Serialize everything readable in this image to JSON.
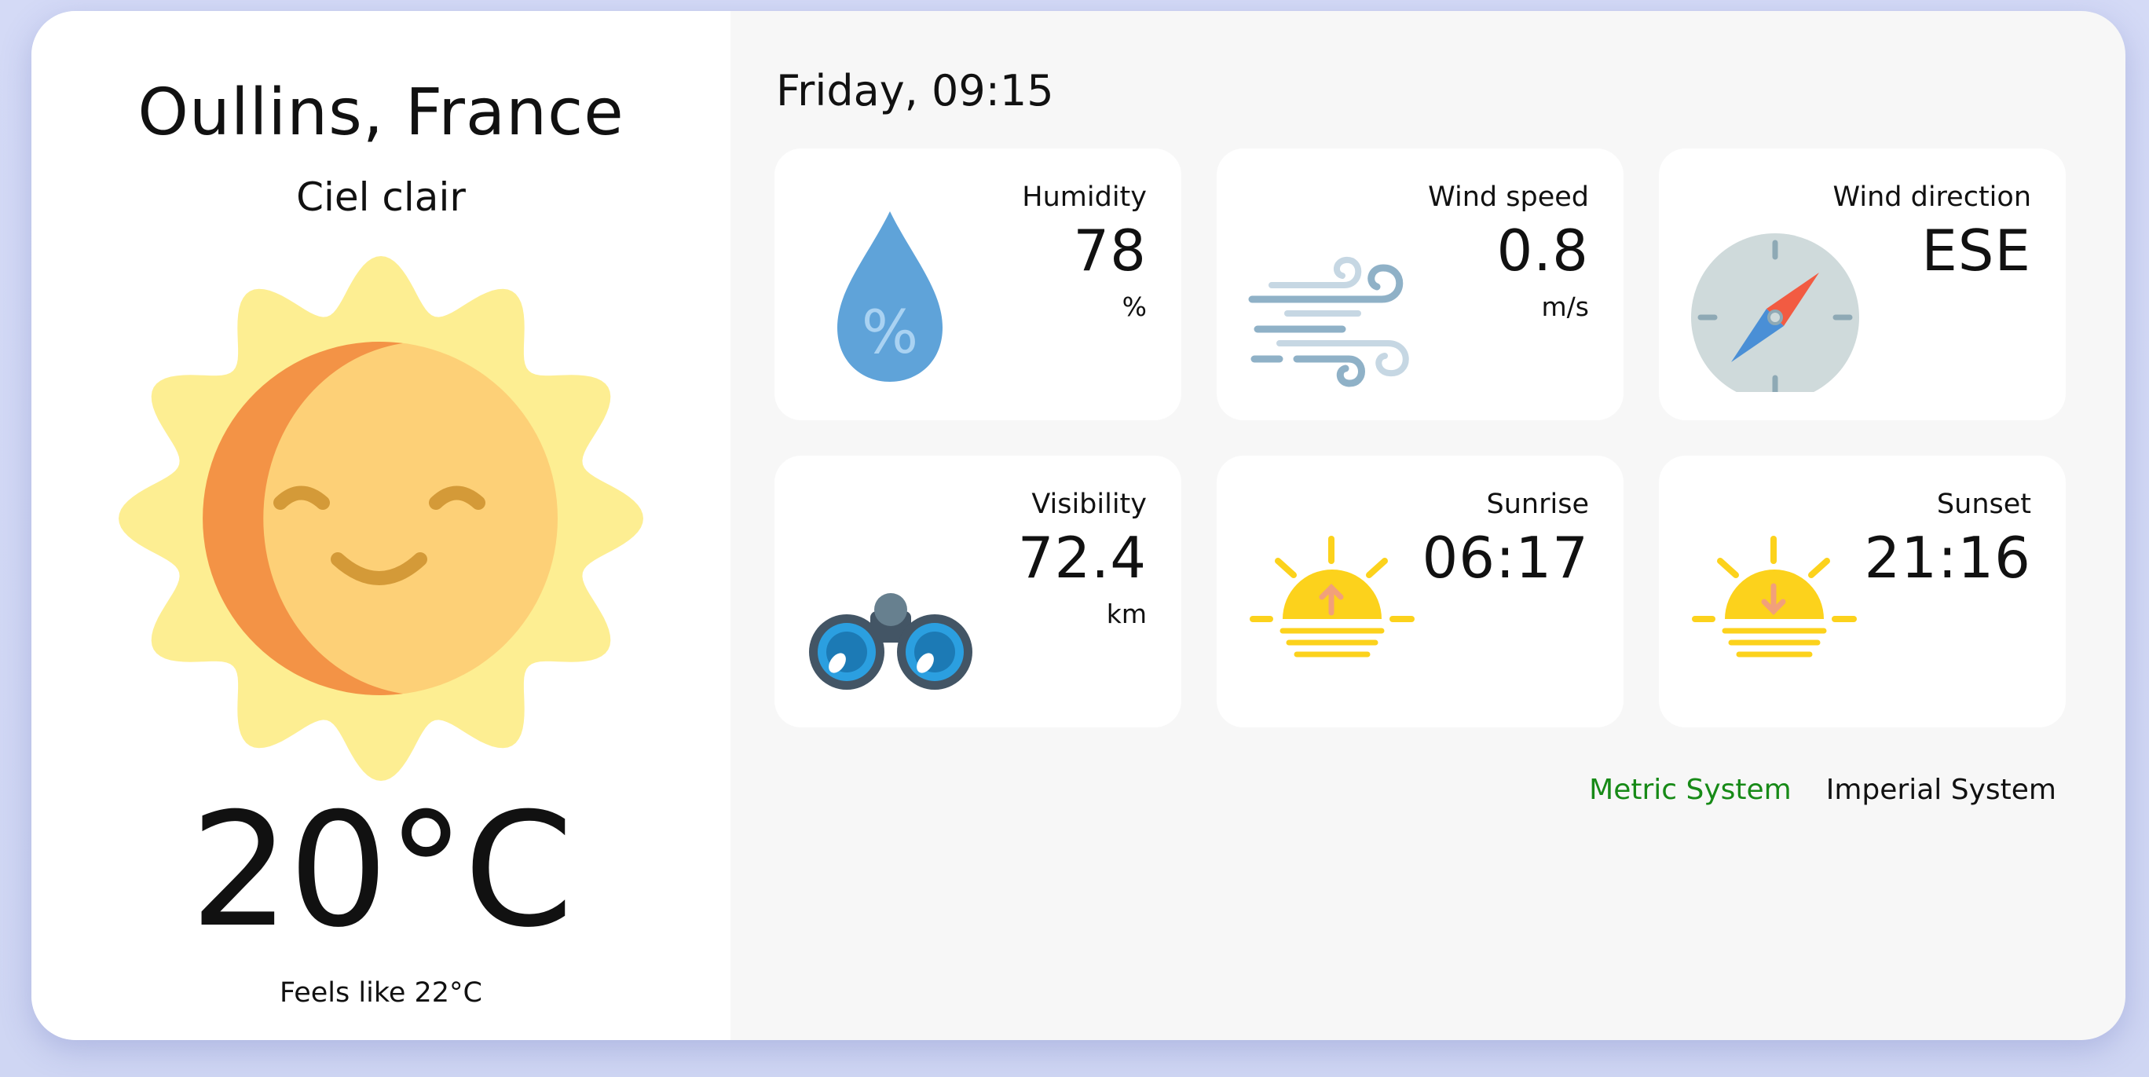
{
  "location": {
    "city": "Oullins, France",
    "description": "Ciel clair",
    "temperature": "20°C",
    "feels_like": "Feels like 22°C",
    "weather_icon": "smiling-sun-icon"
  },
  "datetime": "Friday, 09:15",
  "tiles": {
    "humidity": {
      "label": "Humidity",
      "value": "78",
      "unit": "%",
      "icon": "water-drop-percent-icon"
    },
    "wind_speed": {
      "label": "Wind speed",
      "value": "0.8",
      "unit": "m/s",
      "icon": "wind-icon"
    },
    "wind_direction": {
      "label": "Wind direction",
      "value": "ESE",
      "icon": "compass-icon"
    },
    "visibility": {
      "label": "Visibility",
      "value": "72.4",
      "unit": "km",
      "icon": "binoculars-icon"
    },
    "sunrise": {
      "label": "Sunrise",
      "value": "06:17",
      "icon": "sunrise-icon"
    },
    "sunset": {
      "label": "Sunset",
      "value": "21:16",
      "icon": "sunset-icon"
    }
  },
  "units": {
    "metric": "Metric System",
    "imperial": "Imperial System",
    "active": "metric",
    "active_color": "#178a17"
  },
  "colors": {
    "background": "#d3d9f5",
    "panel": "#f7f7f7",
    "tile": "#ffffff",
    "sun_rays": "#fdee92",
    "sun_face": "#fdd077",
    "sun_shadow": "#f39346",
    "water": "#5fa3d9",
    "compass_needle_red": "#f25b42",
    "compass_needle_blue": "#4a8fd6"
  }
}
